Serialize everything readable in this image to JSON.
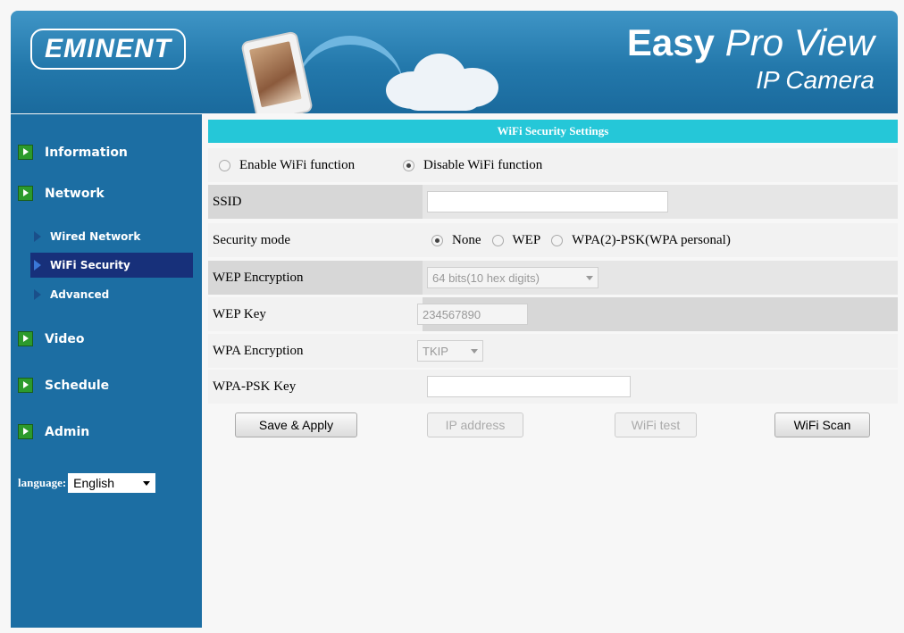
{
  "header": {
    "logo": "EMINENT",
    "brand_easy": "Easy",
    "brand_proview": "Pro View",
    "brand_sub": "IP Camera"
  },
  "sidebar": {
    "items": [
      {
        "label": "Information"
      },
      {
        "label": "Network"
      },
      {
        "label": "Video"
      },
      {
        "label": "Schedule"
      },
      {
        "label": "Admin"
      }
    ],
    "network_sub": [
      {
        "label": "Wired Network"
      },
      {
        "label": "WiFi Security",
        "active": true
      },
      {
        "label": "Advanced"
      }
    ],
    "language_label": "language:",
    "language_value": "English"
  },
  "main": {
    "title": "WiFi Security Settings",
    "wifi_enable_label": "Enable WiFi function",
    "wifi_disable_label": "Disable WiFi function",
    "wifi_selected": "disable",
    "ssid_label": "SSID",
    "ssid_value": "",
    "security_mode_label": "Security mode",
    "security_options": [
      "None",
      "WEP",
      "WPA(2)-PSK(WPA personal)"
    ],
    "security_selected": "None",
    "wep_encryption_label": "WEP Encryption",
    "wep_encryption_value": "64 bits(10 hex digits)",
    "wep_key_label": "WEP Key",
    "wep_key_value": "234567890",
    "wpa_encryption_label": "WPA Encryption",
    "wpa_encryption_value": "TKIP",
    "wpa_psk_label": "WPA-PSK Key",
    "wpa_psk_value": ""
  },
  "buttons": {
    "save": "Save & Apply",
    "ip": "IP address",
    "wifi_test": "WiFi test",
    "wifi_scan": "WiFi Scan"
  },
  "colors": {
    "sidebar": "#1c6ea3",
    "title_bar": "#25c7d8",
    "banner": "#2378ab",
    "active_nav": "#17307a"
  }
}
